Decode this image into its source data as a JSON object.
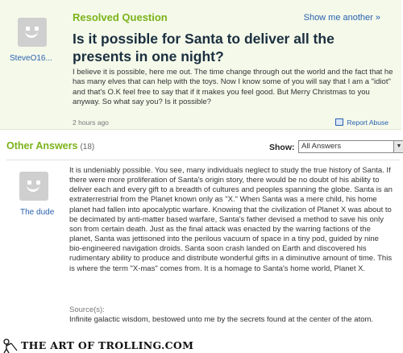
{
  "question": {
    "status": "Resolved Question",
    "show_more": "Show me another »",
    "title": "Is it possible for Santa to deliver all the presents in one night?",
    "body": "I believe it is possible, here me out. The time change through out the world and the fact that he has many elves that can help with the toys. Now I know some of you will say that I am a \"idiot\" and that's O.K feel free to say that if it makes you feel good. But Merry Christmas to you anyway. So what say you? Is it possible?",
    "time": "2 hours ago",
    "report": "Report Abuse",
    "user": "SteveO16..."
  },
  "answers_header": {
    "label": "Other Answers",
    "count": "(18)",
    "show_label": "Show:",
    "sort_selected": "All Answers"
  },
  "answer": {
    "user": "The dude",
    "body": "It is undeniably possible. You see, many individuals neglect to study the true history of Santa. If there were more proliferation of Santa's origin story, there would be no doubt of his ability to deliver each and every gift to a breadth of cultures and peoples spanning the globe. Santa is an extraterrestrial from the Planet known only as \"X.\" When Santa was a mere child, his home planet had fallen into apocalyptic warfare. Knowing that the civilization of Planet X was about to be decimated by anti-matter based warfare, Santa's father devised a method to save his only son from certain death. Just as the final attack was enacted by the warring factions of the planet, Santa was jettisoned into the perilous vacuum of space in a tiny pod, guided by nine bio-engineered navigation droids. Santa soon crash landed on Earth and discovered his rudimentary ability to produce and distribute wonderful gifts in a diminutive amount of time. This is where the term \"X-mas\" comes from. It is a homage to Santa's home world, Planet X.",
    "sources_label": "Source(s):",
    "sources": "Infinite galactic wisdom, bestowed unto me by the secrets found at the center of the atom."
  },
  "watermark": "THE ART OF TROLLING.COM",
  "colors": {
    "accent_green": "#7bb31a",
    "link_blue": "#2a62b0",
    "question_bg": "#f4f9ea"
  }
}
